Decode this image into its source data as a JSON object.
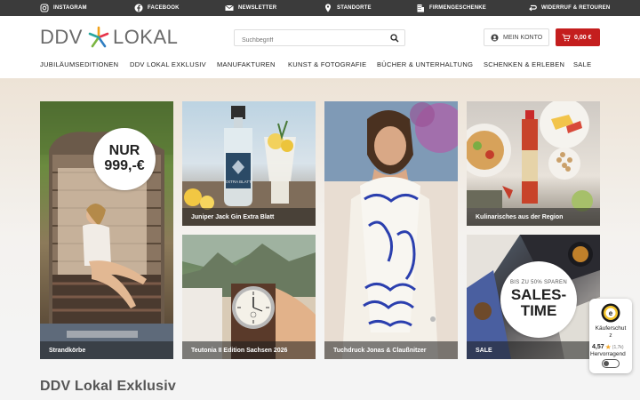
{
  "topbar": {
    "items": [
      {
        "label": "INSTAGRAM",
        "icon": "instagram-icon"
      },
      {
        "label": "FACEBOOK",
        "icon": "facebook-icon"
      },
      {
        "label": "NEWSLETTER",
        "icon": "mail-icon"
      },
      {
        "label": "STANDORTE",
        "icon": "location-pin-icon"
      },
      {
        "label": "FIRMENGESCHENKE",
        "icon": "building-icon"
      },
      {
        "label": "WIDERRUF & RETOUREN",
        "icon": "return-arrow-icon"
      }
    ]
  },
  "header": {
    "logo_left": "DDV",
    "logo_right": "LOKAL",
    "search_placeholder": "Suchbegriff",
    "account_label": "MEIN KONTO",
    "cart_label": "0,00 €"
  },
  "nav": {
    "items": [
      "JUBILÄUMSEDITIONEN",
      "DDV LOKAL EXKLUSIV",
      "MANUFAKTUREN",
      "KUNST & FOTOGRAFIE",
      "BÜCHER & UNTERHALTUNG",
      "SCHENKEN & ERLEBEN",
      "SALE"
    ]
  },
  "tiles": {
    "strandkoerbe": {
      "caption": "Strandkörbe",
      "badge_line1": "NUR",
      "badge_line2": "999,-€"
    },
    "gin": {
      "caption": "Juniper Jack Gin Extra Blatt",
      "bottle_label": "EXTRA BLATT"
    },
    "watch": {
      "caption": "Teutonia II Edition Sachsen 2026"
    },
    "tuch": {
      "caption": "Tuchdruck Jonas & Claußnitzer"
    },
    "kulinarisches": {
      "caption": "Kulinarisches aus der Region"
    },
    "sale": {
      "caption": "SALE",
      "badge_small": "BIS ZU 50% SPAREN",
      "badge_big1": "SALES-",
      "badge_big2": "TIME"
    }
  },
  "section_title": "DDV Lokal Exklusiv",
  "trust": {
    "title_line1": "Käuferschut",
    "title_line2": "z",
    "rating": "4,57",
    "count": "(1,7k)",
    "verdict": "Hervorragend",
    "seal_letter": "e"
  },
  "colors": {
    "accent": "#c41e1e",
    "topbar": "#3b3b3b"
  }
}
